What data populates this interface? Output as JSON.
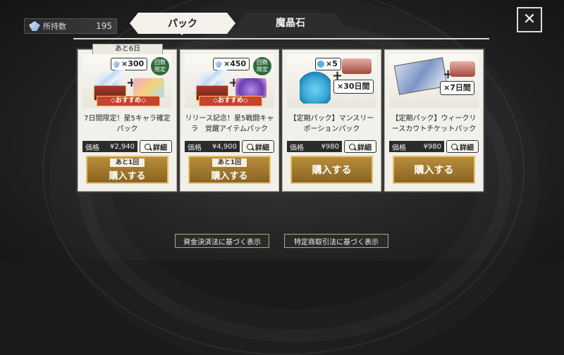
{
  "currency": {
    "label": "所持数",
    "count": "195"
  },
  "tabs": [
    {
      "label": "パック",
      "selected": true
    },
    {
      "label": "魔晶石",
      "selected": false
    }
  ],
  "close_label": "✕",
  "cards": [
    {
      "badge": "あと6日",
      "qty": "×300",
      "limited": "回数限定",
      "recommend": "◇おすすめ◇",
      "title": "7日間限定！星5キャラ確定パック",
      "price_label": "価格",
      "price": "¥2,940",
      "detail": "詳細",
      "remaining": "あと1回",
      "buy": "購入する"
    },
    {
      "qty": "×450",
      "limited": "回数限定",
      "recommend": "◇おすすめ◇",
      "title": "リリース記念！星5戦闘キャラ　覚醒アイテムパック",
      "price_label": "価格",
      "price": "¥4,900",
      "detail": "詳細",
      "remaining": "あと1回",
      "buy": "購入する"
    },
    {
      "qty": "×5",
      "days": "×30日間",
      "title": "【定期パック】マンスリーポーションパック",
      "price_label": "価格",
      "price": "¥980",
      "detail": "詳細",
      "buy": "購入する"
    },
    {
      "days": "×7日間",
      "title": "【定期パック】ウィークリースカウトチケットパック",
      "price_label": "価格",
      "price": "¥980",
      "detail": "詳細",
      "buy": "購入する"
    }
  ],
  "footer": {
    "payment_law": "資金決済法に基づく表示",
    "commerce_law": "特定商取引法に基づく表示"
  }
}
